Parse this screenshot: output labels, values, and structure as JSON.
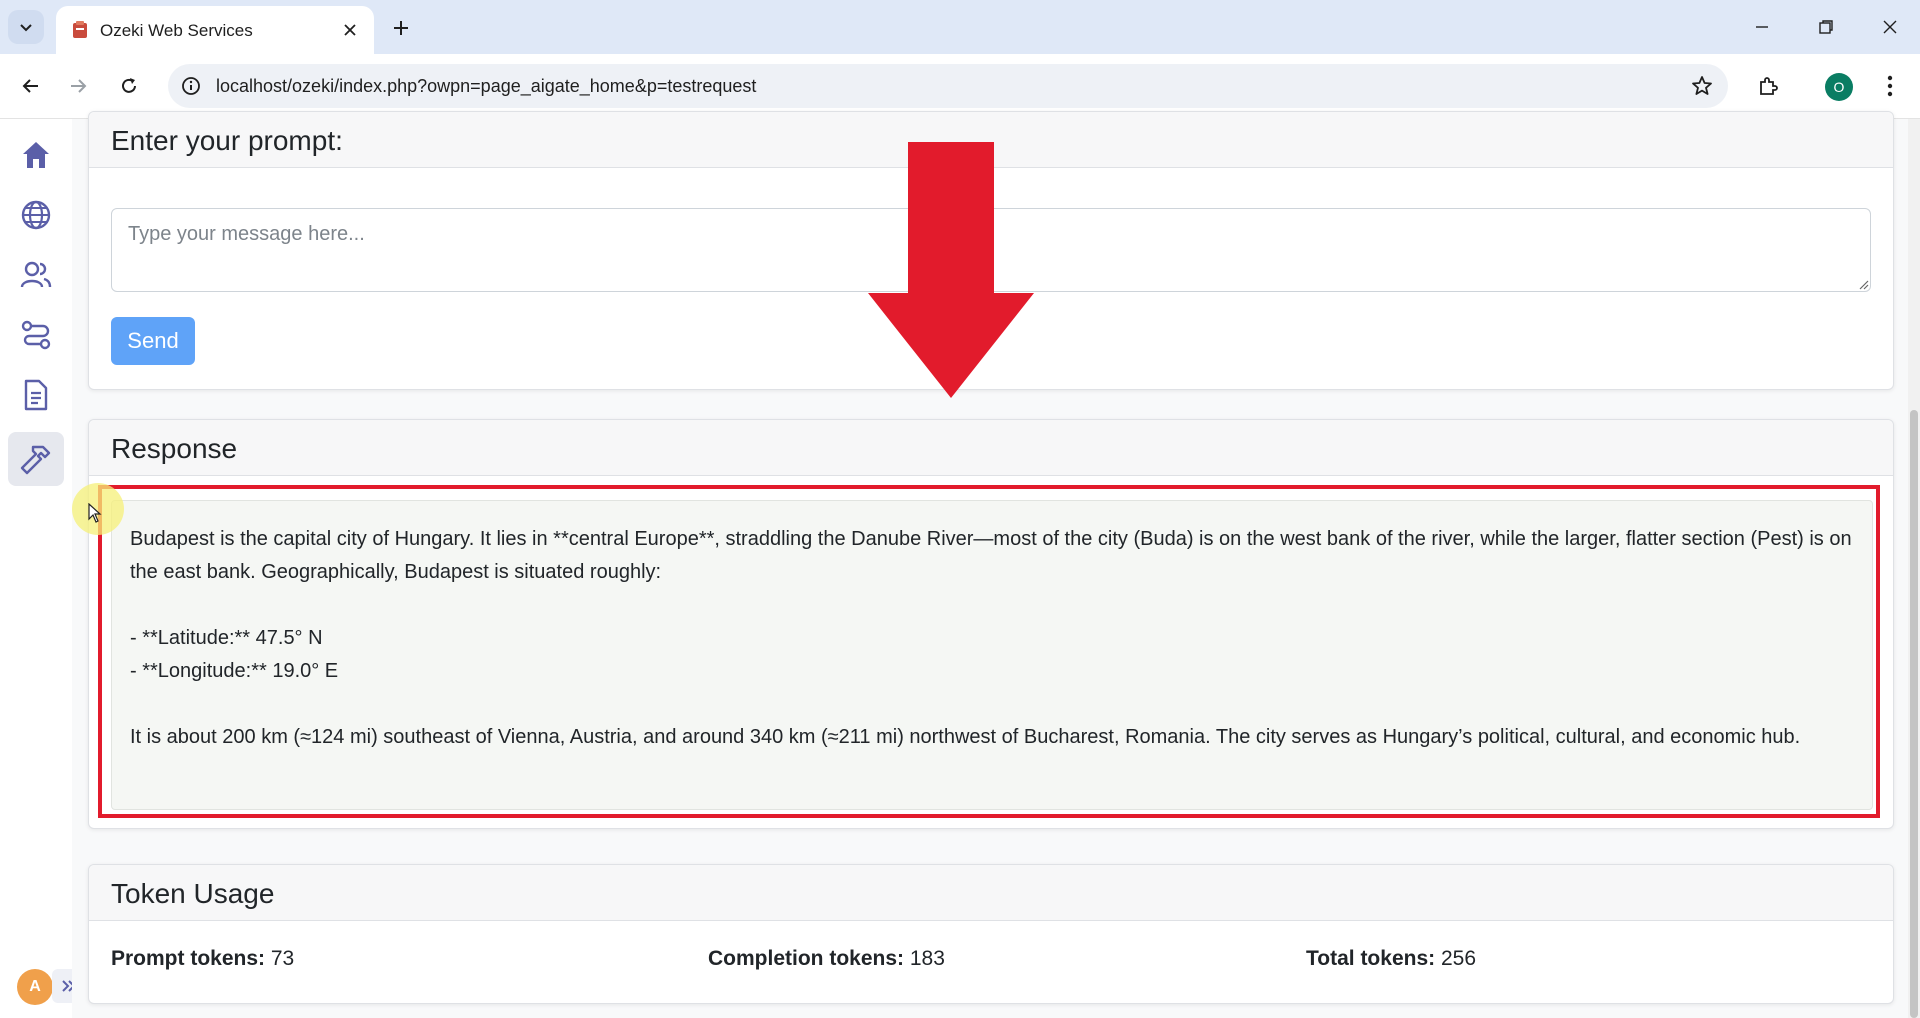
{
  "browser": {
    "tab_title": "Ozeki Web Services",
    "url": "localhost/ozeki/index.php?owpn=page_aigate_home&p=testrequest",
    "profile_initial": "O"
  },
  "sidebar": {
    "items": [
      {
        "icon": "home-icon"
      },
      {
        "icon": "globe-icon"
      },
      {
        "icon": "users-icon"
      },
      {
        "icon": "routes-icon"
      },
      {
        "icon": "document-icon"
      },
      {
        "icon": "hammer-icon",
        "active": true
      }
    ],
    "user_initial": "A"
  },
  "prompt": {
    "title": "Enter your prompt:",
    "placeholder": "Type your message here...",
    "value": "",
    "send_label": "Send"
  },
  "response": {
    "title": "Response",
    "paragraphs": [
      "Budapest is the capital city of Hungary. It lies in **central Europe**, straddling the Danube River—most of the city (Buda) is on the west bank of the river, while the larger, flatter section (Pest) is on the east bank. Geographically, Budapest is situated roughly:",
      "- **Latitude:** 47.5° N",
      "- **Longitude:** 19.0° E",
      "It is about 200 km (≈124 mi) southeast of Vienna, Austria, and around 340 km (≈211 mi) northwest of Bucharest, Romania. The city serves as Hungary’s political, cultural, and economic hub."
    ]
  },
  "tokens": {
    "title": "Token Usage",
    "prompt_label": "Prompt tokens:",
    "prompt_value": "73",
    "completion_label": "Completion tokens:",
    "completion_value": "183",
    "total_label": "Total tokens:",
    "total_value": "256"
  },
  "annotation": {
    "color": "#e21b2c"
  },
  "colors": {
    "send_button": "#5fa3f8",
    "sidebar_icon": "#5b5fa8"
  }
}
